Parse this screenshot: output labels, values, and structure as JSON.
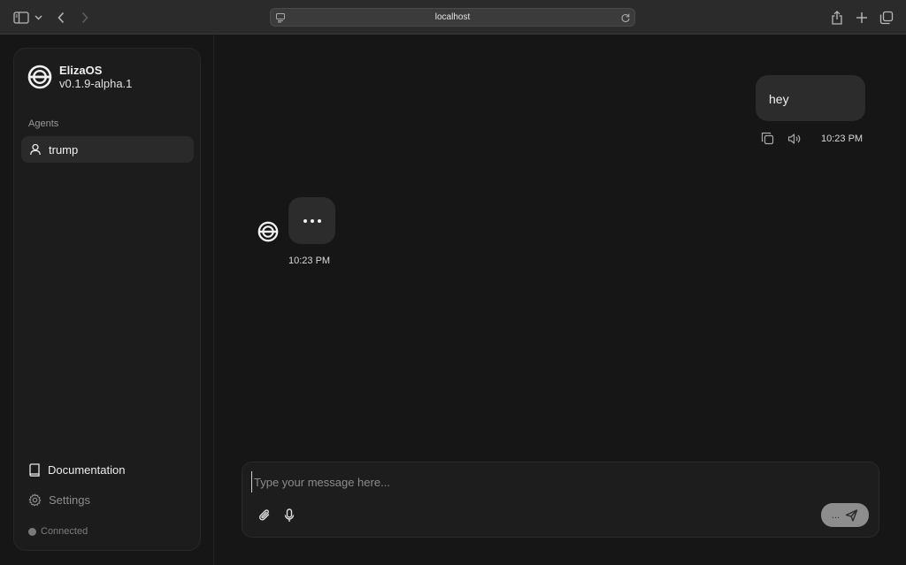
{
  "browser": {
    "url": "localhost"
  },
  "sidebar": {
    "brand_name": "ElizaOS",
    "version": "v0.1.9-alpha.1",
    "agents_label": "Agents",
    "agents": [
      {
        "name": "trump"
      }
    ],
    "documentation_label": "Documentation",
    "settings_label": "Settings",
    "status_label": "Connected"
  },
  "chat": {
    "messages": [
      {
        "role": "user",
        "text": "hey",
        "time": "10:23 PM"
      },
      {
        "role": "agent",
        "text": "...",
        "time": "10:23 PM",
        "typing": true
      }
    ]
  },
  "composer": {
    "placeholder": "Type your message here...",
    "send_label": "..."
  },
  "colors": {
    "background": "#161616",
    "sidebar": "#1c1c1c",
    "bubble": "#2c2c2c",
    "send_button": "#8d8d8d"
  }
}
